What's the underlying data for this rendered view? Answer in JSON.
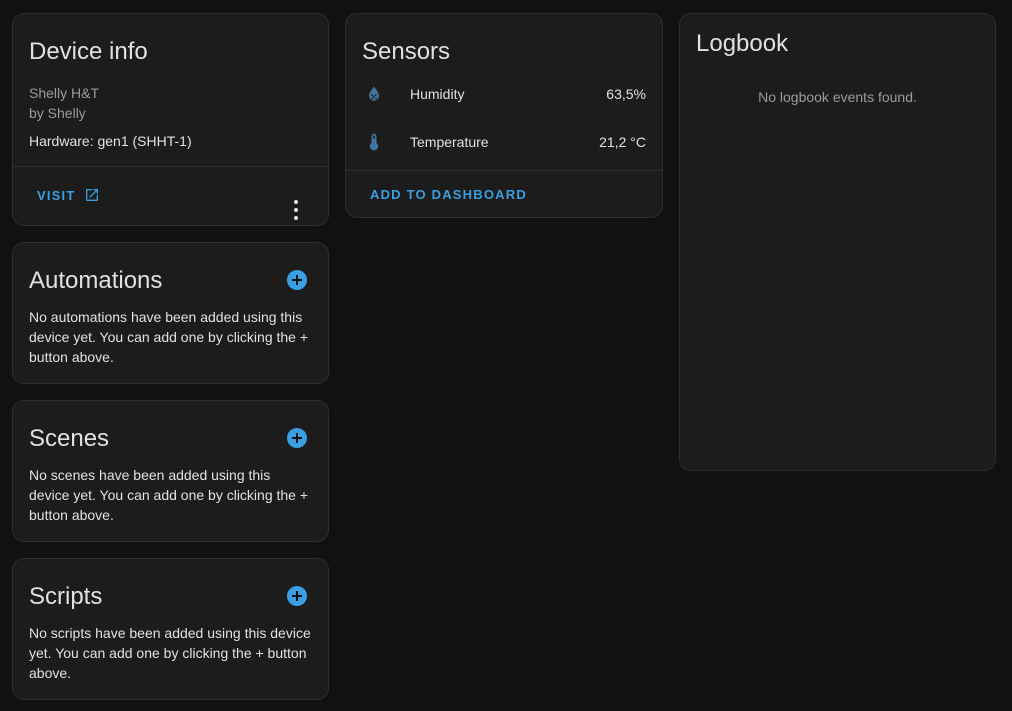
{
  "device_info": {
    "title": "Device info",
    "model": "Shelly H&T",
    "manufacturer": "by Shelly",
    "hardware": "Hardware: gen1 (SHHT-1)",
    "visit_label": "VISIT"
  },
  "automations": {
    "title": "Automations",
    "empty_text": "No automations have been added using this device yet. You can add one by clicking the + button above."
  },
  "scenes": {
    "title": "Scenes",
    "empty_text": "No scenes have been added using this device yet. You can add one by clicking the + button above."
  },
  "scripts": {
    "title": "Scripts",
    "empty_text": "No scripts have been added using this device yet. You can add one by clicking the + button above."
  },
  "sensors": {
    "title": "Sensors",
    "items": [
      {
        "name": "Humidity",
        "value": "63,5%",
        "icon": "water-percent-icon"
      },
      {
        "name": "Temperature",
        "value": "21,2 °C",
        "icon": "thermometer-icon"
      }
    ],
    "add_label": "ADD TO DASHBOARD"
  },
  "logbook": {
    "title": "Logbook",
    "empty_text": "No logbook events found."
  },
  "colors": {
    "accent": "#3a9fe2",
    "icon_blue": "#44739e",
    "background": "#111111",
    "card": "#1c1c1c"
  }
}
